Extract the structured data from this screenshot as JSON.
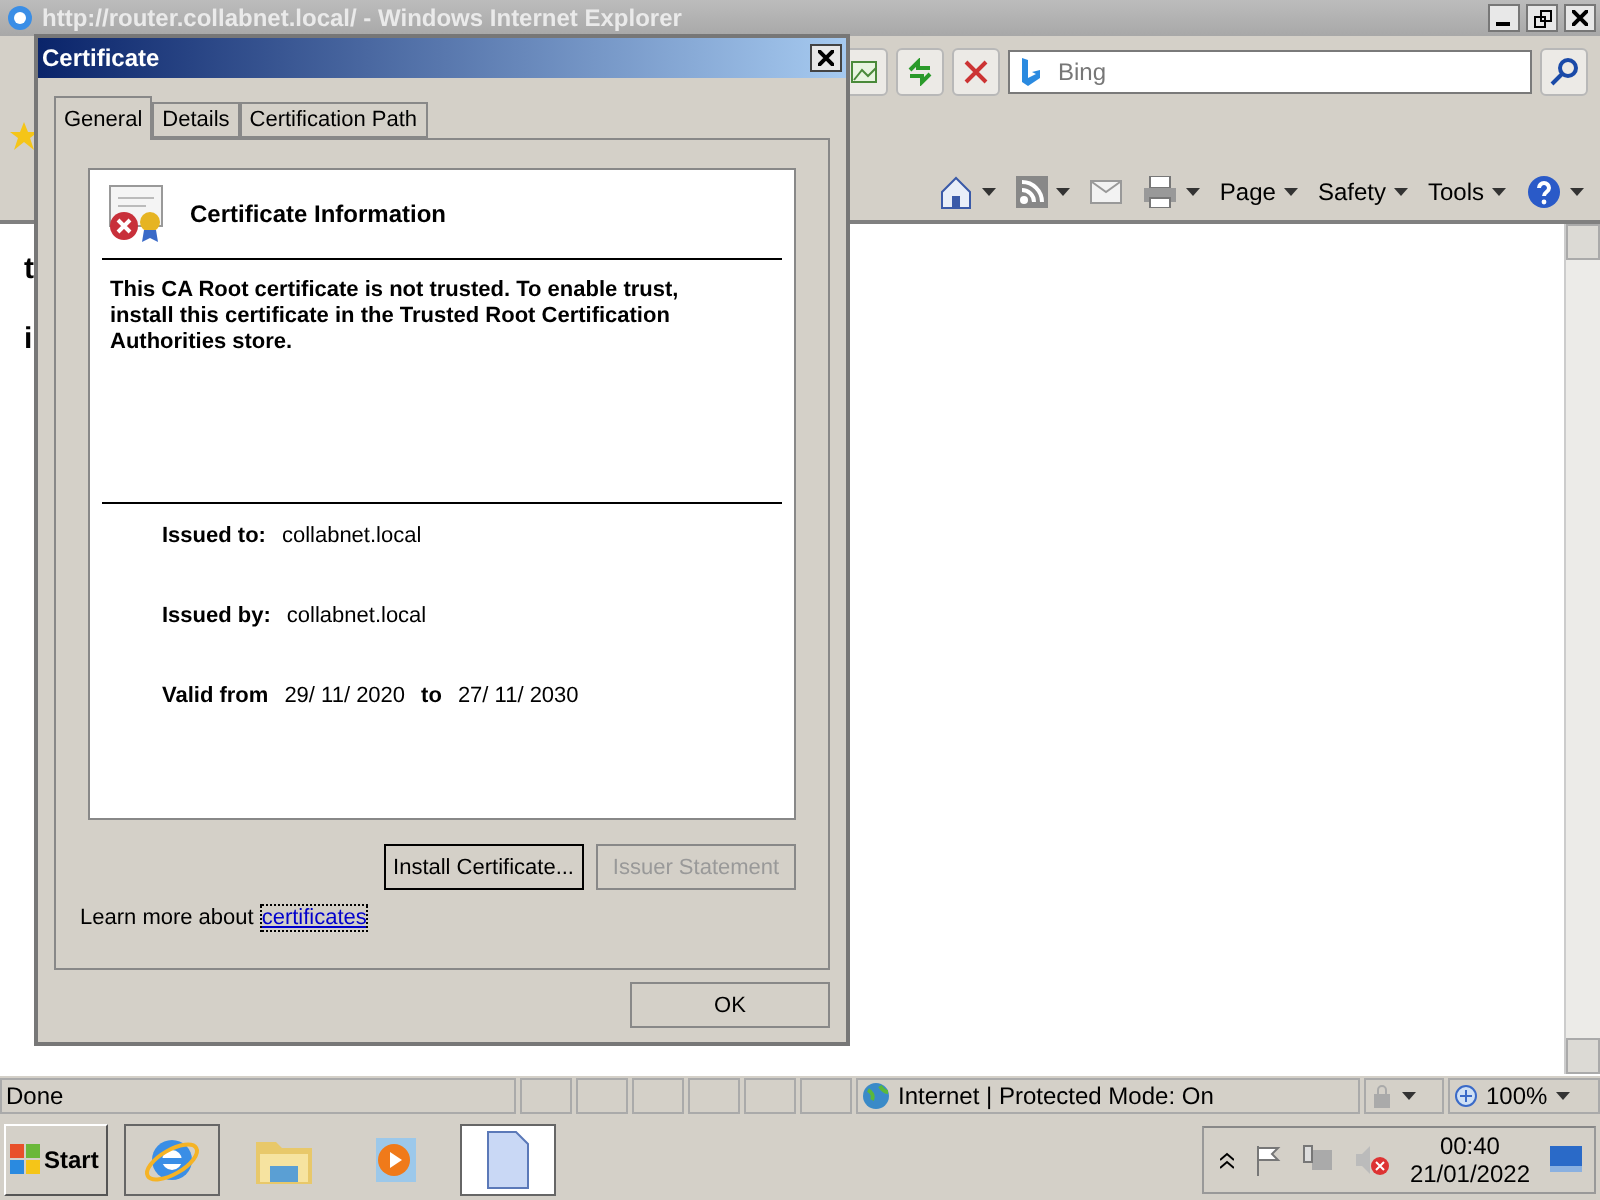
{
  "browser": {
    "title": "http://router.collabnet.local/ - Windows Internet Explorer",
    "search_placeholder": "Bing",
    "command_bar": [
      "Page",
      "Safety",
      "Tools"
    ],
    "page_fragments": [
      "t",
      "i"
    ],
    "status": "Done",
    "zone": "Internet | Protected Mode: On",
    "zoom": "100%"
  },
  "dialog": {
    "title": "Certificate",
    "tabs": [
      {
        "label": "General",
        "selected": true
      },
      {
        "label": "Details",
        "selected": false
      },
      {
        "label": "Certification Path",
        "selected": false
      }
    ],
    "heading": "Certificate Information",
    "message": "This CA Root certificate is not trusted. To enable trust, install this certificate in the Trusted Root Certification Authorities store.",
    "fields": [
      {
        "label": "Issued to:",
        "value": "collabnet.local"
      },
      {
        "label": "Issued by:",
        "value": "collabnet.local"
      }
    ],
    "validity": {
      "label": "Valid from",
      "from": "29/ 11/ 2020",
      "to_label": "to",
      "to": "27/ 11/ 2030"
    },
    "buttons": [
      {
        "label": "Install Certificate...",
        "disabled": false
      },
      {
        "label": "Issuer Statement",
        "disabled": true
      }
    ],
    "learn_more": "Learn more about",
    "link": "certificates",
    "ok": "OK"
  },
  "taskbar": {
    "start": "Start",
    "apps": [
      {
        "kind": "ie",
        "selected": false
      },
      {
        "kind": "folder",
        "selected": false
      },
      {
        "kind": "media",
        "selected": false
      },
      {
        "kind": "document",
        "selected": true
      }
    ],
    "time": "00:40",
    "date": "21/01/2022"
  }
}
